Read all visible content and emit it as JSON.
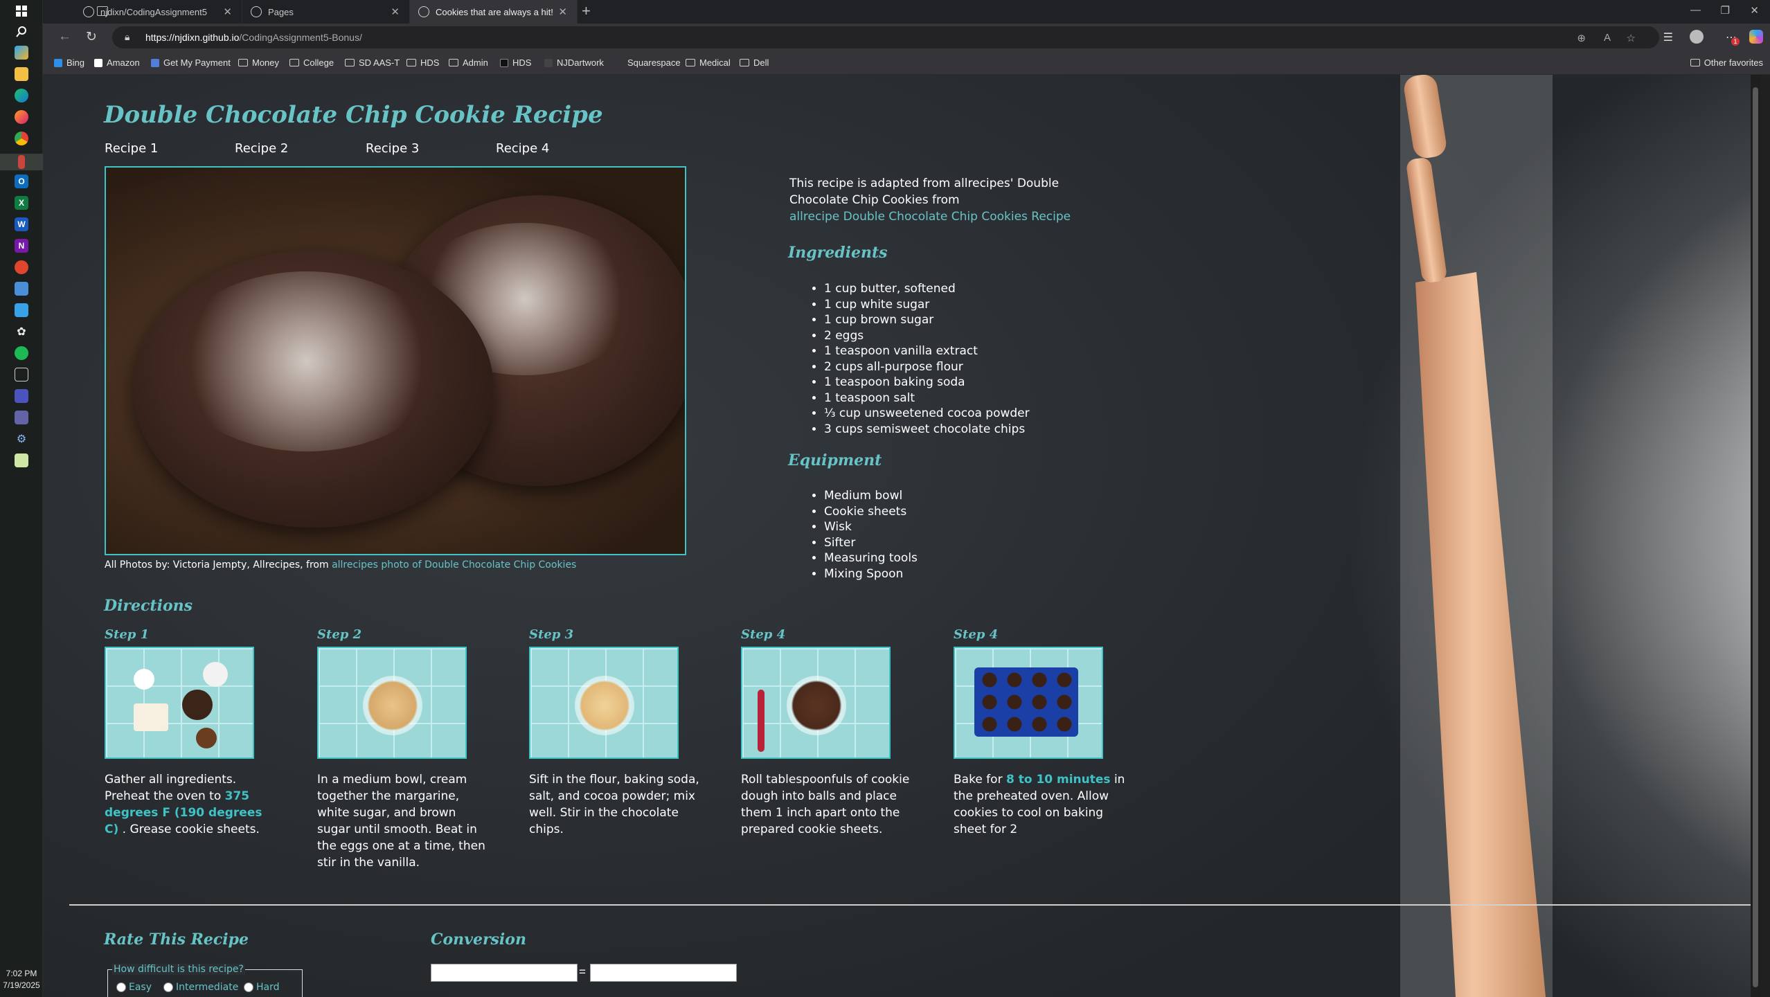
{
  "taskbar": {
    "time": "7:02 PM",
    "date": "7/19/2025",
    "icons": [
      "windows-start-icon",
      "search-icon",
      "copilot-icon",
      "file-explorer-icon",
      "edge-icon",
      "firefox-icon",
      "chrome-icon",
      "pinned-app-icon",
      "outlook-icon",
      "excel-icon",
      "word-icon",
      "onenote-icon",
      "media-icon",
      "settings-icon",
      "store-icon",
      "puzzle-icon",
      "green-app-icon",
      "terminal-icon",
      "teams-icon",
      "teams-icon-2",
      "settings-gear-icon",
      "notepad-icon"
    ]
  },
  "browser": {
    "tabs": [
      {
        "label": "njdixn/CodingAssignment5",
        "icon": "github-icon"
      },
      {
        "label": "Pages",
        "icon": "github-icon"
      },
      {
        "label": "Cookies that are always a hit!",
        "icon": "globe-icon"
      }
    ],
    "url_host": "https://njdixn.github.io",
    "url_path": "/CodingAssignment5-Bonus/",
    "favorites": [
      {
        "label": "Bing",
        "type": "site"
      },
      {
        "label": "Amazon",
        "type": "site"
      },
      {
        "label": "Get My Payment",
        "type": "site"
      },
      {
        "label": "Money",
        "type": "folder"
      },
      {
        "label": "College",
        "type": "folder"
      },
      {
        "label": "SD AAS-T",
        "type": "folder"
      },
      {
        "label": "HDS",
        "type": "folder"
      },
      {
        "label": "Admin",
        "type": "folder"
      },
      {
        "label": "HDS",
        "type": "site"
      },
      {
        "label": "NJDartwork",
        "type": "site"
      },
      {
        "label": "Squarespace",
        "type": "site"
      },
      {
        "label": "Medical",
        "type": "folder"
      },
      {
        "label": "Dell",
        "type": "folder"
      }
    ],
    "other_favorites": "Other favorites",
    "notification_badge": "1"
  },
  "page": {
    "title": "Double Chocolate Chip Cookie Recipe",
    "nav": [
      "Recipe 1",
      "Recipe 2",
      "Recipe 3",
      "Recipe 4"
    ],
    "photo_credit_prefix": "All Photos by: Victoria Jempty, Allrecipes, from ",
    "photo_credit_link": "allrecipes photo of Double Chocolate Chip Cookies",
    "intro_text": "This recipe is adapted from allrecipes' Double Chocolate Chip Cookies from",
    "intro_link": "allrecipe Double Chocolate Chip Cookies Recipe",
    "ingredients_heading": "Ingredients",
    "ingredients": [
      "1 cup butter, softened",
      "1 cup white sugar",
      "1 cup brown sugar",
      "2 eggs",
      "1 teaspoon vanilla extract",
      "2 cups all-purpose flour",
      "1 teaspoon baking soda",
      "1 teaspoon salt",
      "⅓ cup unsweetened cocoa powder",
      "3 cups semisweet chocolate chips"
    ],
    "equipment_heading": "Equipment",
    "equipment": [
      "Medium bowl",
      "Cookie sheets",
      "Wisk",
      "Sifter",
      "Measuring tools",
      "Mixing Spoon"
    ],
    "directions_heading": "Directions",
    "steps": [
      {
        "label": "Step 1",
        "text_a": "Gather all ingredients. Preheat the oven to ",
        "highlight": "375 degrees F (190 degrees C)",
        "text_b": " . Grease cookie sheets."
      },
      {
        "label": "Step 2",
        "text_a": "In a medium bowl, cream together the margarine, white sugar, and brown sugar until smooth. Beat in the eggs one at a time, then stir in the vanilla.",
        "highlight": "",
        "text_b": ""
      },
      {
        "label": "Step 3",
        "text_a": "Sift in the flour, baking soda, salt, and cocoa powder; mix well. Stir in the chocolate chips.",
        "highlight": "",
        "text_b": ""
      },
      {
        "label": "Step 4",
        "text_a": "Roll tablespoonfuls of cookie dough into balls and place them 1 inch apart onto the prepared cookie sheets.",
        "highlight": "",
        "text_b": ""
      },
      {
        "label": "Step 4",
        "text_a": "Bake for ",
        "highlight": "8 to 10 minutes",
        "text_b": " in the preheated oven. Allow cookies to cool on baking sheet for 2"
      }
    ],
    "rate_heading": "Rate This Recipe",
    "rate_legend": "How difficult is this recipe?",
    "rate_options": [
      "Easy",
      "Intermediate",
      "Hard"
    ],
    "conversion_heading": "Conversion",
    "conversion_equals": "="
  },
  "colors": {
    "accent": "#67c3c6",
    "highlight": "#3ec3c6",
    "text": "#ffffff"
  }
}
